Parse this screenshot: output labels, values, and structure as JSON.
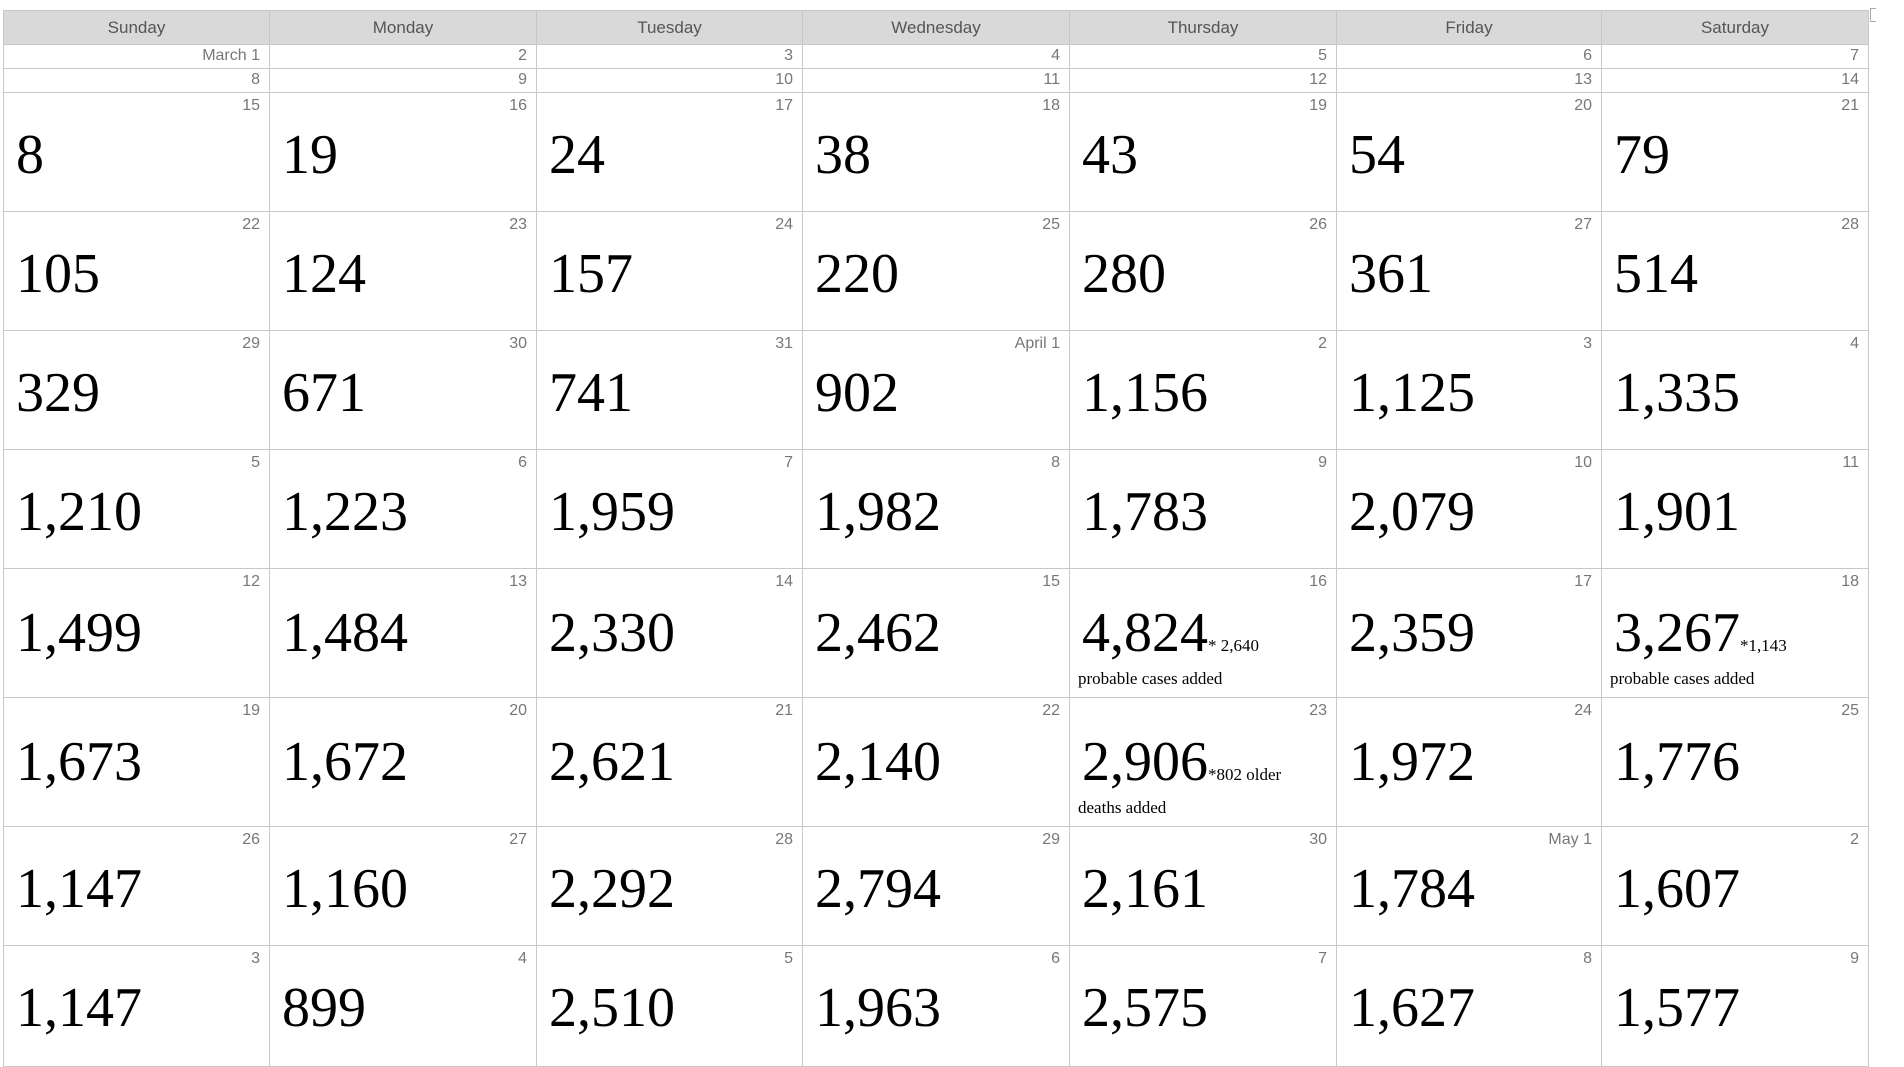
{
  "headers": [
    "Sunday",
    "Monday",
    "Tuesday",
    "Wednesday",
    "Thursday",
    "Friday",
    "Saturday"
  ],
  "weeks": [
    {
      "days": [
        {
          "label": "March 1",
          "value": ""
        },
        {
          "label": "2",
          "value": ""
        },
        {
          "label": "3",
          "value": ""
        },
        {
          "label": "4",
          "value": ""
        },
        {
          "label": "5",
          "value": ""
        },
        {
          "label": "6",
          "value": ""
        },
        {
          "label": "7",
          "value": ""
        }
      ]
    },
    {
      "days": [
        {
          "label": "8",
          "value": ""
        },
        {
          "label": "9",
          "value": ""
        },
        {
          "label": "10",
          "value": ""
        },
        {
          "label": "11",
          "value": ""
        },
        {
          "label": "12",
          "value": ""
        },
        {
          "label": "13",
          "value": ""
        },
        {
          "label": "14",
          "value": ""
        }
      ]
    },
    {
      "days": [
        {
          "label": "15",
          "value": "8"
        },
        {
          "label": "16",
          "value": "19"
        },
        {
          "label": "17",
          "value": "24"
        },
        {
          "label": "18",
          "value": "38"
        },
        {
          "label": "19",
          "value": "43"
        },
        {
          "label": "20",
          "value": "54"
        },
        {
          "label": "21",
          "value": "79"
        }
      ]
    },
    {
      "days": [
        {
          "label": "22",
          "value": "105"
        },
        {
          "label": "23",
          "value": "124"
        },
        {
          "label": "24",
          "value": "157"
        },
        {
          "label": "25",
          "value": "220"
        },
        {
          "label": "26",
          "value": "280"
        },
        {
          "label": "27",
          "value": "361"
        },
        {
          "label": "28",
          "value": "514"
        }
      ]
    },
    {
      "days": [
        {
          "label": "29",
          "value": "329"
        },
        {
          "label": "30",
          "value": "671"
        },
        {
          "label": "31",
          "value": "741"
        },
        {
          "label": "April 1",
          "value": "902"
        },
        {
          "label": "2",
          "value": "1,156"
        },
        {
          "label": "3",
          "value": "1,125"
        },
        {
          "label": "4",
          "value": "1,335"
        }
      ]
    },
    {
      "days": [
        {
          "label": "5",
          "value": "1,210"
        },
        {
          "label": "6",
          "value": "1,223"
        },
        {
          "label": "7",
          "value": "1,959"
        },
        {
          "label": "8",
          "value": "1,982"
        },
        {
          "label": "9",
          "value": "1,783"
        },
        {
          "label": "10",
          "value": "2,079"
        },
        {
          "label": "11",
          "value": "1,901"
        }
      ]
    },
    {
      "days": [
        {
          "label": "12",
          "value": "1,499"
        },
        {
          "label": "13",
          "value": "1,484"
        },
        {
          "label": "14",
          "value": "2,330"
        },
        {
          "label": "15",
          "value": "2,462"
        },
        {
          "label": "16",
          "value": "4,824",
          "note_inline": "* 2,640",
          "note_line": "probable cases added"
        },
        {
          "label": "17",
          "value": "2,359"
        },
        {
          "label": "18",
          "value": "3,267",
          "note_inline": "*1,143",
          "note_line": "probable cases added"
        }
      ]
    },
    {
      "days": [
        {
          "label": "19",
          "value": "1,673"
        },
        {
          "label": "20",
          "value": "1,672"
        },
        {
          "label": "21",
          "value": "2,621"
        },
        {
          "label": "22",
          "value": "2,140"
        },
        {
          "label": "23",
          "value": "2,906",
          "note_inline": "*802 older",
          "note_line": "deaths added"
        },
        {
          "label": "24",
          "value": "1,972"
        },
        {
          "label": "25",
          "value": "1,776"
        }
      ]
    },
    {
      "days": [
        {
          "label": "26",
          "value": "1,147"
        },
        {
          "label": "27",
          "value": "1,160"
        },
        {
          "label": "28",
          "value": "2,292"
        },
        {
          "label": "29",
          "value": "2,794"
        },
        {
          "label": "30",
          "value": "2,161"
        },
        {
          "label": "May 1",
          "value": "1,784"
        },
        {
          "label": "2",
          "value": "1,607"
        }
      ]
    },
    {
      "days": [
        {
          "label": "3",
          "value": "1,147"
        },
        {
          "label": "4",
          "value": "899"
        },
        {
          "label": "5",
          "value": "2,510"
        },
        {
          "label": "6",
          "value": "1,963"
        },
        {
          "label": "7",
          "value": "2,575"
        },
        {
          "label": "8",
          "value": "1,627"
        },
        {
          "label": "9",
          "value": "1,577"
        }
      ]
    }
  ]
}
